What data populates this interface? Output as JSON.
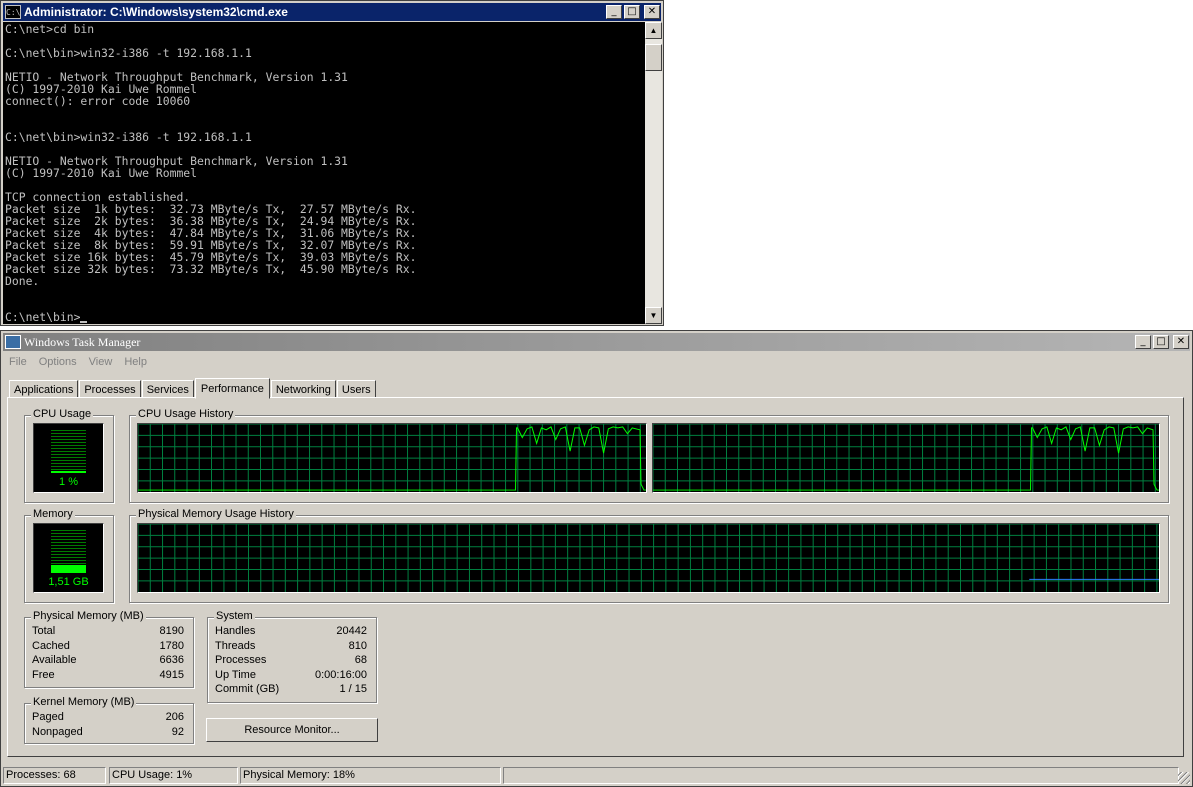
{
  "cmd": {
    "title": "Administrator: C:\\Windows\\system32\\cmd.exe",
    "icon_text": "C:\\",
    "buttons": {
      "minimize": "_",
      "maximize": "□",
      "close": "✕"
    },
    "lines": [
      "C:\\net>cd bin",
      "",
      "C:\\net\\bin>win32-i386 -t 192.168.1.1",
      "",
      "NETIO - Network Throughput Benchmark, Version 1.31",
      "(C) 1997-2010 Kai Uwe Rommel",
      "connect(): error code 10060",
      "",
      "",
      "C:\\net\\bin>win32-i386 -t 192.168.1.1",
      "",
      "NETIO - Network Throughput Benchmark, Version 1.31",
      "(C) 1997-2010 Kai Uwe Rommel",
      "",
      "TCP connection established.",
      "Packet size  1k bytes:  32.73 MByte/s Tx,  27.57 MByte/s Rx.",
      "Packet size  2k bytes:  36.38 MByte/s Tx,  24.94 MByte/s Rx.",
      "Packet size  4k bytes:  47.84 MByte/s Tx,  31.06 MByte/s Rx.",
      "Packet size  8k bytes:  59.91 MByte/s Tx,  32.07 MByte/s Rx.",
      "Packet size 16k bytes:  45.79 MByte/s Tx,  39.03 MByte/s Rx.",
      "Packet size 32k bytes:  73.32 MByte/s Tx,  45.90 MByte/s Rx.",
      "Done.",
      "",
      ""
    ],
    "prompt": "C:\\net\\bin>",
    "scroll": {
      "up": "▲",
      "down": "▼"
    }
  },
  "taskmgr": {
    "title": "Windows Task Manager",
    "buttons": {
      "minimize": "_",
      "maximize": "□",
      "close": "✕"
    },
    "menu": [
      "File",
      "Options",
      "View",
      "Help"
    ],
    "tabs": [
      "Applications",
      "Processes",
      "Services",
      "Performance",
      "Networking",
      "Users"
    ],
    "active_tab": "Performance",
    "cpu_usage": {
      "label": "CPU Usage",
      "value_text": "1 %",
      "level": 0.01
    },
    "cpu_history": {
      "label": "CPU Usage History"
    },
    "memory": {
      "label": "Memory",
      "value_text": "1,51 GB",
      "level": 0.18
    },
    "memory_history": {
      "label": "Physical Memory Usage History"
    },
    "physical_memory": {
      "label": "Physical Memory (MB)",
      "rows": [
        {
          "name": "Total",
          "value": "8190"
        },
        {
          "name": "Cached",
          "value": "1780"
        },
        {
          "name": "Available",
          "value": "6636"
        },
        {
          "name": "Free",
          "value": "4915"
        }
      ]
    },
    "kernel_memory": {
      "label": "Kernel Memory (MB)",
      "rows": [
        {
          "name": "Paged",
          "value": "206"
        },
        {
          "name": "Nonpaged",
          "value": "92"
        }
      ]
    },
    "system": {
      "label": "System",
      "rows": [
        {
          "name": "Handles",
          "value": "20442"
        },
        {
          "name": "Threads",
          "value": "810"
        },
        {
          "name": "Processes",
          "value": "68"
        },
        {
          "name": "Up Time",
          "value": "0:00:16:00"
        },
        {
          "name": "Commit (GB)",
          "value": "1 / 15"
        }
      ]
    },
    "resource_monitor_button": "Resource Monitor...",
    "status": {
      "processes": "Processes: 68",
      "cpu": "CPU Usage: 1%",
      "memory": "Physical Memory: 18%"
    },
    "colors": {
      "graph_line": "#00ff00",
      "grid": "#008040",
      "memory_line": "#2a7fff",
      "window_face": "#d4d0c8"
    }
  }
}
